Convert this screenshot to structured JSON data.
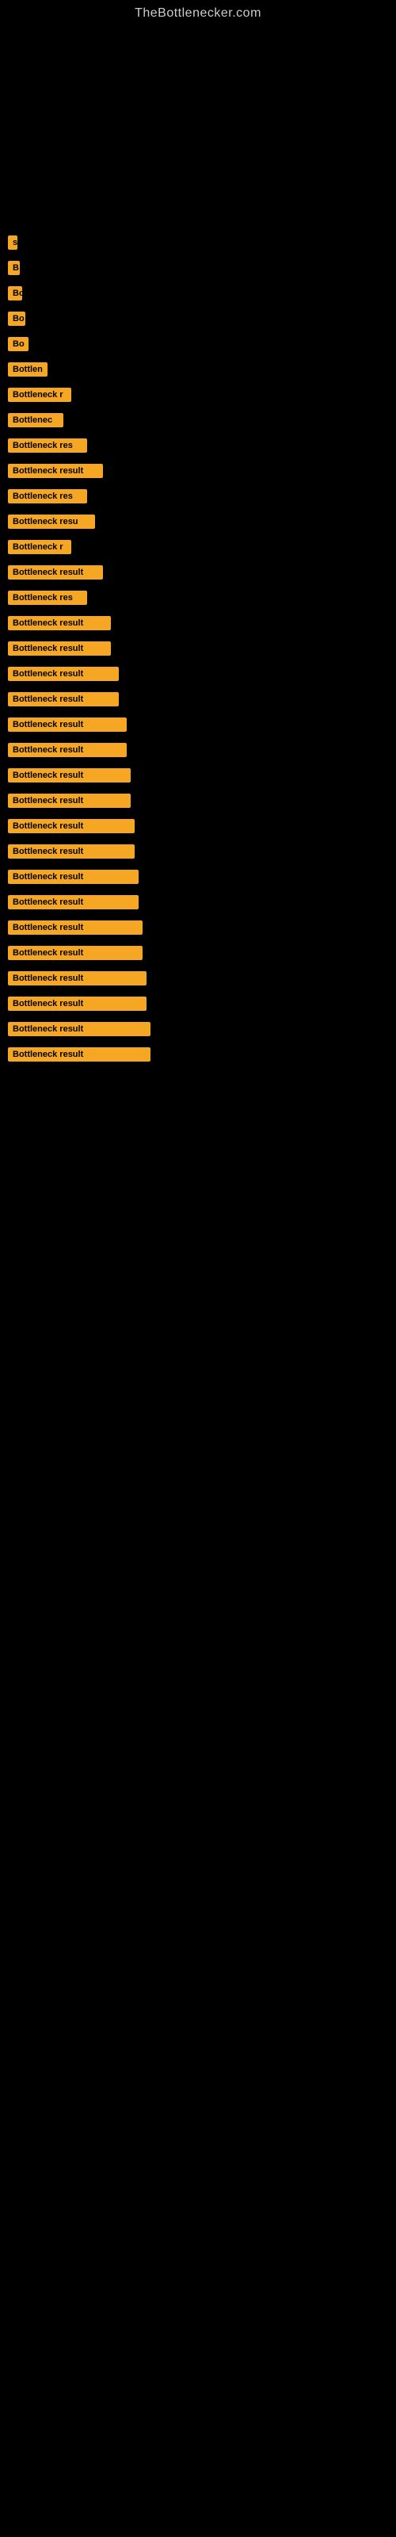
{
  "header": {
    "site_title": "TheBottlenecker.com"
  },
  "bars": [
    {
      "label": "",
      "width": 5
    },
    {
      "label": "",
      "width": 8
    },
    {
      "label": "",
      "width": 5
    },
    {
      "label": "",
      "width": 8
    },
    {
      "label": "",
      "width": 5
    },
    {
      "label": "",
      "width": 8
    },
    {
      "label": "",
      "width": 5
    },
    {
      "label": "",
      "width": 8
    },
    {
      "label": "s",
      "width": 12
    },
    {
      "label": "B",
      "width": 15
    },
    {
      "label": "Bo",
      "width": 18
    },
    {
      "label": "Bo",
      "width": 22
    },
    {
      "label": "Bo",
      "width": 26
    },
    {
      "label": "Bottlen",
      "width": 50
    },
    {
      "label": "Bottleneck r",
      "width": 80
    },
    {
      "label": "Bottlenec",
      "width": 70
    },
    {
      "label": "Bottleneck res",
      "width": 100
    },
    {
      "label": "Bottleneck result",
      "width": 120
    },
    {
      "label": "Bottleneck res",
      "width": 100
    },
    {
      "label": "Bottleneck resu",
      "width": 110
    },
    {
      "label": "Bottleneck r",
      "width": 80
    },
    {
      "label": "Bottleneck result",
      "width": 120
    },
    {
      "label": "Bottleneck res",
      "width": 100
    },
    {
      "label": "Bottleneck result",
      "width": 130
    },
    {
      "label": "Bottleneck result",
      "width": 130
    },
    {
      "label": "Bottleneck result",
      "width": 140
    },
    {
      "label": "Bottleneck result",
      "width": 140
    },
    {
      "label": "Bottleneck result",
      "width": 150
    },
    {
      "label": "Bottleneck result",
      "width": 150
    },
    {
      "label": "Bottleneck result",
      "width": 155
    },
    {
      "label": "Bottleneck result",
      "width": 155
    },
    {
      "label": "Bottleneck result",
      "width": 160
    },
    {
      "label": "Bottleneck result",
      "width": 160
    },
    {
      "label": "Bottleneck result",
      "width": 165
    },
    {
      "label": "Bottleneck result",
      "width": 165
    },
    {
      "label": "Bottleneck result",
      "width": 170
    },
    {
      "label": "Bottleneck result",
      "width": 170
    },
    {
      "label": "Bottleneck result",
      "width": 175
    },
    {
      "label": "Bottleneck result",
      "width": 175
    },
    {
      "label": "Bottleneck result",
      "width": 180
    },
    {
      "label": "Bottleneck result",
      "width": 180
    }
  ]
}
